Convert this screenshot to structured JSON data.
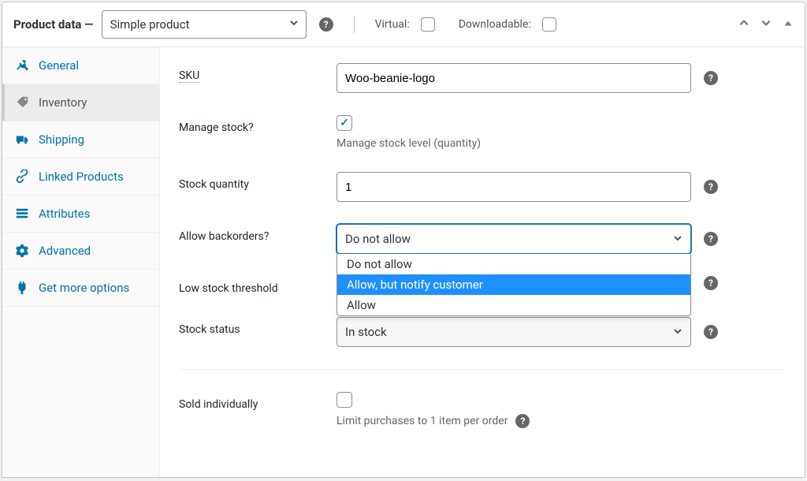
{
  "header": {
    "title": "Product data —",
    "product_type": "Simple product",
    "virtual_label": "Virtual:",
    "downloadable_label": "Downloadable:",
    "virtual_checked": false,
    "downloadable_checked": false
  },
  "tabs": [
    {
      "id": "general",
      "label": "General",
      "icon": "wrench"
    },
    {
      "id": "inventory",
      "label": "Inventory",
      "icon": "tag",
      "active": true
    },
    {
      "id": "shipping",
      "label": "Shipping",
      "icon": "truck"
    },
    {
      "id": "linked",
      "label": "Linked Products",
      "icon": "link"
    },
    {
      "id": "attributes",
      "label": "Attributes",
      "icon": "list"
    },
    {
      "id": "advanced",
      "label": "Advanced",
      "icon": "gear"
    },
    {
      "id": "getmore",
      "label": "Get more options",
      "icon": "plugin"
    }
  ],
  "fields": {
    "sku": {
      "label": "SKU",
      "value": "Woo-beanie-logo"
    },
    "manage_stock": {
      "label": "Manage stock?",
      "checked": true,
      "desc": "Manage stock level (quantity)"
    },
    "stock_quantity": {
      "label": "Stock quantity",
      "value": "1"
    },
    "backorders": {
      "label": "Allow backorders?",
      "value": "Do not allow",
      "open": true,
      "options": [
        "Do not allow",
        "Allow, but notify customer",
        "Allow"
      ],
      "highlighted": "Allow, but notify customer"
    },
    "low_stock": {
      "label": "Low stock threshold",
      "value": ""
    },
    "stock_status": {
      "label": "Stock status",
      "value": "In stock"
    },
    "sold_individually": {
      "label": "Sold individually",
      "checked": false,
      "desc": "Limit purchases to 1 item per order"
    }
  }
}
